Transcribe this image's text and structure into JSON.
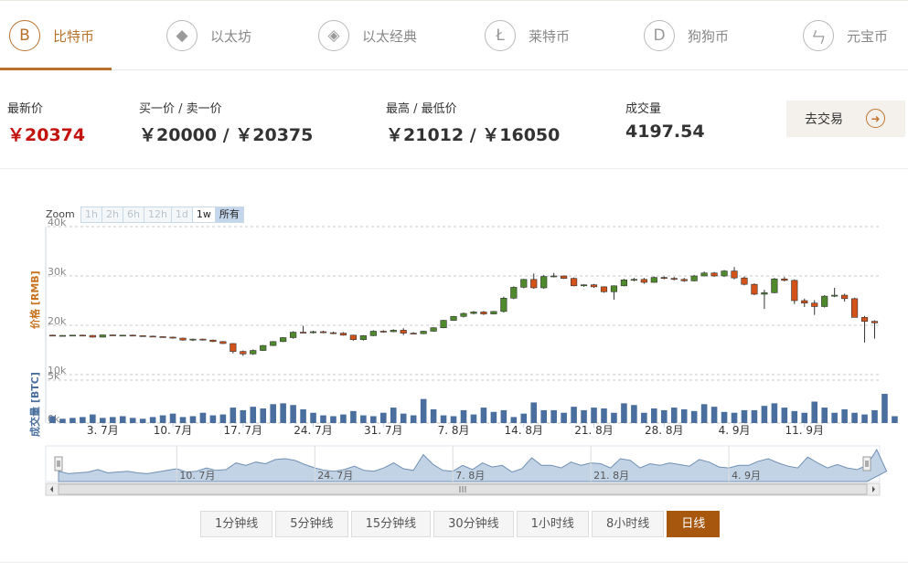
{
  "tabs": [
    {
      "label": "比特币",
      "icon": "bitcoin-icon",
      "glyph": "B"
    },
    {
      "label": "以太坊",
      "icon": "ethereum-icon",
      "glyph": "◆"
    },
    {
      "label": "以太经典",
      "icon": "ethereum-classic-icon",
      "glyph": "◈"
    },
    {
      "label": "莱特币",
      "icon": "litecoin-icon",
      "glyph": "Ł"
    },
    {
      "label": "狗狗币",
      "icon": "dogecoin-icon",
      "glyph": "D"
    },
    {
      "label": "元宝币",
      "icon": "yuanbao-icon",
      "glyph": "ㄣ"
    }
  ],
  "stats": {
    "latest_label": "最新价",
    "latest_value": "￥20374",
    "bidask_label": "买一价 / 卖一价",
    "bidask_value": "￥20000 / ￥20375",
    "highlow_label": "最高 / 最低价",
    "highlow_value": "￥21012 / ￥16050",
    "volume_label": "成交量",
    "volume_value": "4197.54"
  },
  "trade_button": {
    "label": "去交易"
  },
  "zoom": {
    "label": "Zoom",
    "buttons": [
      "1h",
      "2h",
      "6h",
      "12h",
      "1d",
      "1w",
      "所有"
    ],
    "selected": "所有"
  },
  "periods": [
    "1分钟线",
    "5分钟线",
    "15分钟线",
    "30分钟线",
    "1小时线",
    "8小时线",
    "日线"
  ],
  "active_period": "日线",
  "colors": {
    "accent": "#b8722c",
    "up": "#4e8a2c",
    "down": "#d2521a",
    "volume": "#4a6f9e",
    "price_red": "#c3130f"
  },
  "chart_data": {
    "type": "candlestick",
    "price_axis_label": "价格 [RMB]",
    "volume_axis_label": "成交量 [BTC]",
    "price_ticks": [
      "10k",
      "20k",
      "30k",
      "40k"
    ],
    "price_ylim": [
      10000,
      40000
    ],
    "volume_ticks": [
      "0k",
      "5k"
    ],
    "volume_ylim": [
      0,
      5000
    ],
    "x_ticks": [
      "3. 7月",
      "10. 7月",
      "17. 7月",
      "24. 7月",
      "31. 7月",
      "7. 8月",
      "14. 8月",
      "21. 8月",
      "28. 8月",
      "4. 9月",
      "11. 9月"
    ],
    "navigator_ticks": [
      "10. 7月",
      "24. 7月",
      "7. 8月",
      "21. 8月",
      "4. 9月"
    ],
    "candles": [
      [
        18000,
        18100,
        17800,
        17900
      ],
      [
        17900,
        18000,
        17800,
        17950
      ],
      [
        17950,
        18050,
        17850,
        18000
      ],
      [
        18000,
        18100,
        17900,
        17950
      ],
      [
        17950,
        18000,
        17500,
        17600
      ],
      [
        17600,
        18100,
        17550,
        18050
      ],
      [
        18050,
        18100,
        17900,
        17950
      ],
      [
        17950,
        18050,
        17850,
        18000
      ],
      [
        18000,
        18100,
        17850,
        17900
      ],
      [
        17900,
        17950,
        17750,
        17800
      ],
      [
        17800,
        17900,
        17600,
        17700
      ],
      [
        17700,
        17800,
        17500,
        17600
      ],
      [
        17600,
        17700,
        17300,
        17400
      ],
      [
        17400,
        17500,
        16900,
        17000
      ],
      [
        17000,
        17300,
        16800,
        17200
      ],
      [
        17200,
        17300,
        16900,
        17000
      ],
      [
        17000,
        17100,
        16600,
        16700
      ],
      [
        16700,
        16800,
        16200,
        16300
      ],
      [
        16300,
        16400,
        14300,
        14700
      ],
      [
        14700,
        14900,
        13800,
        14200
      ],
      [
        14200,
        15100,
        14000,
        14900
      ],
      [
        14900,
        16000,
        14800,
        15900
      ],
      [
        15900,
        16800,
        15800,
        16700
      ],
      [
        16700,
        17600,
        16600,
        17500
      ],
      [
        17500,
        18800,
        17300,
        18600
      ],
      [
        18600,
        19900,
        18400,
        18500
      ],
      [
        18500,
        18900,
        18300,
        18700
      ],
      [
        18700,
        18900,
        18400,
        18500
      ],
      [
        18500,
        18700,
        18200,
        18400
      ],
      [
        18400,
        18600,
        17900,
        18000
      ],
      [
        18000,
        18100,
        16900,
        17100
      ],
      [
        17100,
        18000,
        16900,
        17900
      ],
      [
        17900,
        19000,
        17800,
        18800
      ],
      [
        18800,
        19000,
        18500,
        18700
      ],
      [
        18700,
        19200,
        18600,
        19000
      ],
      [
        19000,
        19400,
        18000,
        18400
      ],
      [
        18400,
        18600,
        18200,
        18300
      ],
      [
        18300,
        18900,
        18200,
        18800
      ],
      [
        18800,
        19600,
        18700,
        19500
      ],
      [
        19500,
        21100,
        19400,
        21000
      ],
      [
        21000,
        21900,
        20900,
        21800
      ],
      [
        21800,
        22600,
        21600,
        22400
      ],
      [
        22400,
        22900,
        22200,
        22700
      ],
      [
        22700,
        22900,
        22100,
        22300
      ],
      [
        22300,
        22900,
        22200,
        22800
      ],
      [
        22800,
        25800,
        22600,
        25500
      ],
      [
        25500,
        27900,
        25300,
        27700
      ],
      [
        27700,
        29400,
        27500,
        29300
      ],
      [
        29300,
        30500,
        27400,
        27600
      ],
      [
        27600,
        30200,
        27400,
        29900
      ],
      [
        29900,
        30600,
        29700,
        30000
      ],
      [
        30000,
        30100,
        29400,
        29500
      ],
      [
        29500,
        29700,
        27900,
        28000
      ],
      [
        28000,
        28300,
        27800,
        28200
      ],
      [
        28200,
        28400,
        27600,
        27800
      ],
      [
        27800,
        27900,
        26600,
        26800
      ],
      [
        26800,
        28100,
        25200,
        28000
      ],
      [
        28000,
        29400,
        27900,
        29200
      ],
      [
        29200,
        29600,
        28900,
        29300
      ],
      [
        29300,
        29600,
        28400,
        28700
      ],
      [
        28700,
        29900,
        28600,
        29700
      ],
      [
        29700,
        29900,
        29300,
        29500
      ],
      [
        29500,
        29800,
        29100,
        29300
      ],
      [
        29300,
        29600,
        28800,
        29000
      ],
      [
        29000,
        30200,
        28900,
        30000
      ],
      [
        30000,
        30900,
        29900,
        30600
      ],
      [
        30600,
        30800,
        29800,
        30000
      ],
      [
        30000,
        31200,
        29800,
        31000
      ],
      [
        31000,
        31800,
        29300,
        29600
      ],
      [
        29600,
        29900,
        28100,
        28300
      ],
      [
        28300,
        28500,
        26100,
        26300
      ],
      [
        26300,
        27200,
        23300,
        26600
      ],
      [
        26600,
        29600,
        26500,
        29400
      ],
      [
        29400,
        29800,
        28900,
        29100
      ],
      [
        29100,
        29300,
        24300,
        25000
      ],
      [
        25000,
        25400,
        23700,
        24500
      ],
      [
        24500,
        25100,
        22100,
        23800
      ],
      [
        23800,
        26100,
        23600,
        25900
      ],
      [
        25900,
        27600,
        25700,
        26100
      ],
      [
        26100,
        26400,
        24800,
        25400
      ],
      [
        25400,
        25600,
        22100,
        21600
      ],
      [
        21600,
        21900,
        16500,
        20800
      ],
      [
        20800,
        21000,
        17300,
        20500
      ]
    ],
    "volumes": [
      0.8,
      0.5,
      0.6,
      0.7,
      1.0,
      0.6,
      0.7,
      0.8,
      0.6,
      0.5,
      0.7,
      0.9,
      1.1,
      0.7,
      0.8,
      1.2,
      0.9,
      1.0,
      1.8,
      1.5,
      1.9,
      1.7,
      2.2,
      2.3,
      2.1,
      1.6,
      1.2,
      0.9,
      0.8,
      1.0,
      1.4,
      0.9,
      0.8,
      1.2,
      1.8,
      1.1,
      0.9,
      2.8,
      1.6,
      0.9,
      0.8,
      1.5,
      1.0,
      1.8,
      1.3,
      1.5,
      0.7,
      1.1,
      2.4,
      1.5,
      1.5,
      1.2,
      1.9,
      1.5,
      1.8,
      1.7,
      1.2,
      2.3,
      2.1,
      1.2,
      1.7,
      1.5,
      1.8,
      1.6,
      1.4,
      2.2,
      1.9,
      1.3,
      1.2,
      1.5,
      1.5,
      2.0,
      2.3,
      1.8,
      1.4,
      1.2,
      2.5,
      1.8,
      1.2,
      1.6,
      1.2,
      1.0,
      1.5,
      3.4,
      0.8
    ]
  }
}
